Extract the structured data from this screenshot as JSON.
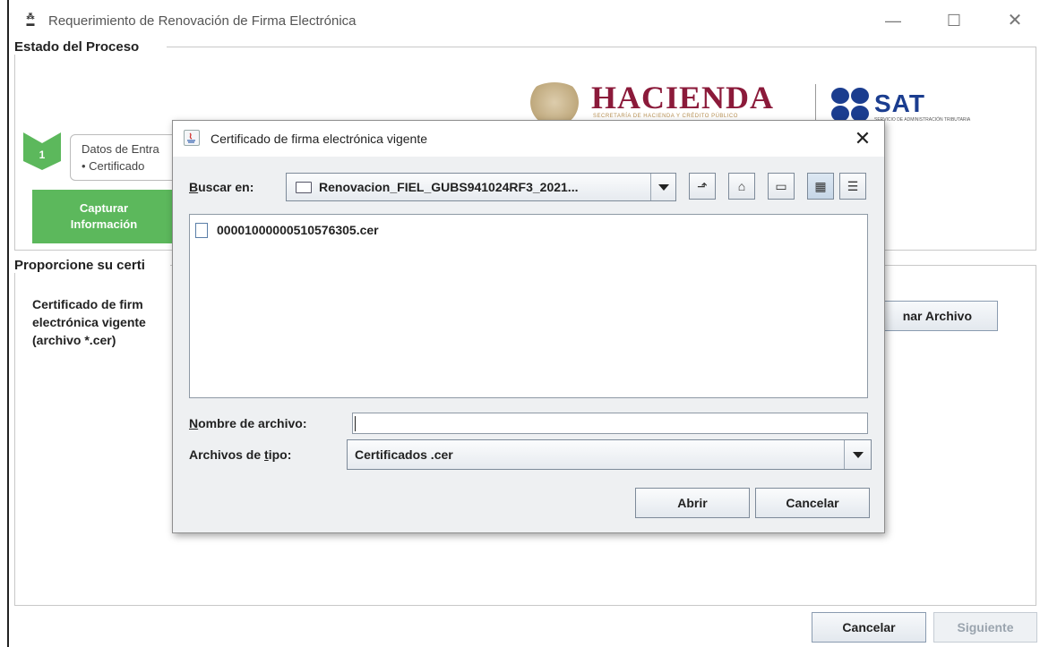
{
  "window": {
    "title": "Requerimiento de Renovación de Firma Electrónica",
    "app_icon": "sat-app-icon",
    "controls": {
      "minimize": "—",
      "maximize": "☐",
      "close": "✕"
    }
  },
  "estado": {
    "section_title": "Estado del Proceso",
    "logo": {
      "hacienda": "HACIENDA",
      "hacienda_sub": "SECRETARÍA DE HACIENDA Y CRÉDITO PÚBLICO",
      "sat": "SAT",
      "sat_sub": "SERVICIO DE ADMINISTRACIÓN TRIBUTARIA"
    },
    "step": {
      "number": "1",
      "title": "Datos de Entra",
      "item": "• Certificado",
      "active_label_line1": "Capturar",
      "active_label_line2": "Información"
    },
    "colors": {
      "step_green": "#5cb85c"
    }
  },
  "form": {
    "section_title": "Proporcione su certi",
    "cert_label_line1": "Certificado de firm",
    "cert_label_line2": "electrónica vigente",
    "cert_label_line3": "(archivo *.cer)",
    "select_file_button": "nar Archivo"
  },
  "footer": {
    "cancel": "Cancelar",
    "next": "Siguiente"
  },
  "dialog": {
    "title": "Certificado de firma electrónica vigente",
    "close": "✕",
    "look_in_label_u": "B",
    "look_in_label_rest": "uscar en:",
    "look_in_value": "Renovacion_FIEL_GUBS941024RF3_2021...",
    "toolbar": [
      {
        "name": "up-one-level-icon",
        "glyph": "⬏"
      },
      {
        "name": "home-icon",
        "glyph": "⌂"
      },
      {
        "name": "new-folder-icon",
        "glyph": "▭"
      },
      {
        "name": "list-view-icon",
        "glyph": "▦"
      },
      {
        "name": "details-view-icon",
        "glyph": "☰"
      }
    ],
    "files": [
      "00001000000510576305.cer"
    ],
    "file_name_label_u": "N",
    "file_name_label_rest": "ombre de archivo:",
    "file_name_value": "",
    "file_type_label_pre": "Archivos de ",
    "file_type_label_u": "t",
    "file_type_label_rest": "ipo:",
    "file_type_value": "Certificados .cer",
    "open_button": "Abrir",
    "cancel_button": "Cancelar"
  }
}
